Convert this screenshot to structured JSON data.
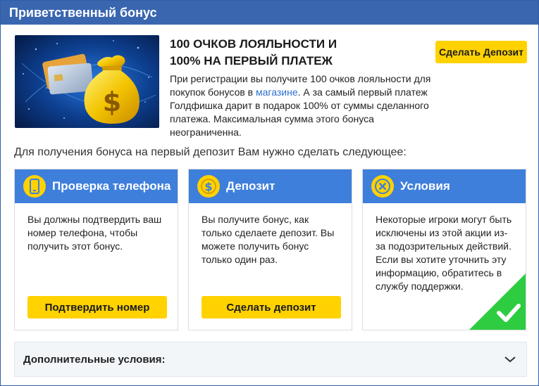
{
  "header": {
    "title": "Приветственный бонус"
  },
  "promo": {
    "title_line1": "100 ОЧКОВ ЛОЯЛЬНОСТИ И",
    "title_line2": "100% НА ПЕРВЫЙ ПЛАТЕЖ",
    "text_before_link": "При регистрации вы получите 100 очков лояльности для покупок бонусов в ",
    "link_text": "магазине",
    "text_after_link": ". А за самый первый платеж Голдфишка дарит в подарок 100% от суммы сделанного платежа. Максимальная сумма этого бонуса неограниченна.",
    "deposit_button": "Сделать Депозит",
    "image_icons": {
      "bag": "money-bag-icon",
      "cards": "credit-cards-icon"
    },
    "colors": {
      "link": "#2f6fd0",
      "button": "#ffd200"
    }
  },
  "instructions": "Для получения бонуса на первый депозит Вам нужно сделать следующее:",
  "cards": [
    {
      "title": "Проверка телефона",
      "icon": "phone-icon",
      "text": "Вы должны подтвердить ваш номер телефона, чтобы получить этот бонус.",
      "button": "Подтвердить номер"
    },
    {
      "title": "Депозит",
      "icon": "dollar-icon",
      "text": "Вы получите бонус, как только сделаете депозит. Вы можете получить бонус только один раз.",
      "button": "Сделать депозит"
    },
    {
      "title": "Условия",
      "icon": "x-circle-icon",
      "text": "Некоторые игроки могут быть исключены из этой акции из-за подозрительных действий. Если вы хотите уточнить эту информацию, обратитесь в службу поддержки.",
      "badge_icon": "checkmark-icon",
      "badge_color": "#2ecc40"
    }
  ],
  "accordion": {
    "label": "Дополнительные условия:",
    "icon": "chevron-down-icon"
  },
  "theme": {
    "header_bg": "#3a66b0",
    "card_header_bg": "#3e7fdc",
    "accent_yellow": "#ffd200"
  }
}
